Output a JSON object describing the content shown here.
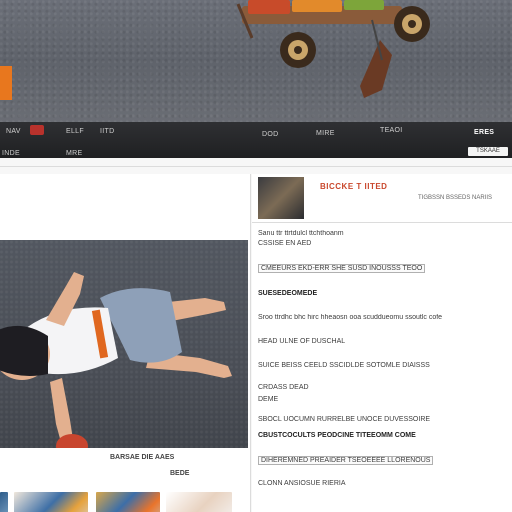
{
  "hero": {
    "icon": "wagon-icon"
  },
  "navbar": {
    "items": [
      {
        "label": "NAV",
        "active": false
      },
      {
        "label": "ELLF",
        "active": false
      },
      {
        "label": "IITD",
        "active": false
      },
      {
        "label": "DOD",
        "active": false
      },
      {
        "label": "MIRE",
        "active": false
      },
      {
        "label": "TEAOI",
        "active": false
      },
      {
        "label": "ERES",
        "active": true
      }
    ],
    "sub_items": [
      {
        "label": "INDE"
      },
      {
        "label": "MRE"
      }
    ],
    "button_label": "TSKAAE"
  },
  "article": {
    "headline": "BICCKE T  IITED",
    "meta": "TIGBSSN BSSEDS NARIIS",
    "lines": [
      {
        "text": "Sanu ttr ttrtdulcl ttchthoanm",
        "style": "normal"
      },
      {
        "text": "CSSISE EN AED",
        "style": "normal"
      },
      {
        "text": "CMEEURS EKD-ERR SHE SUSD INOUSSS TEOO",
        "style": "boxed"
      },
      {
        "text": "SUESEDEOMEDE",
        "style": "bold"
      },
      {
        "text": "Sroo ttrdhc bhc hirc hheaosn ooa scuddueomu ssoutlc cofe",
        "style": "normal"
      },
      {
        "text": "HEAD ULNE OF DUSCHAL",
        "style": "normal"
      },
      {
        "text": "SUICE BEISS CEELD SSCIDLDE SOTOMLE DIAISSS",
        "style": "normal"
      },
      {
        "text": "CRDASS DEAD",
        "style": "normal"
      },
      {
        "text": "DEME",
        "style": "normal"
      },
      {
        "text": "SBOCL UOCUMN RURRELBE UNOCE DUVESSOIRE",
        "style": "normal"
      },
      {
        "text": "CBUSTCOCULTS PEODCINE TITEEOMM COME",
        "style": "bold"
      },
      {
        "text": "DIHEREMNED PREAIDER TSEOEEEE LLORENOUS",
        "style": "boxed"
      },
      {
        "text": "CLONN ANSIOSUE RIERIA",
        "style": "normal"
      }
    ]
  },
  "photo": {
    "caption_line1": "BARSAE DIE AAES",
    "caption_line2": "BEDE"
  },
  "thumbnails": [
    {
      "name": "thumb-1"
    },
    {
      "name": "thumb-2"
    },
    {
      "name": "thumb-3"
    },
    {
      "name": "thumb-4"
    },
    {
      "name": "thumb-5"
    }
  ],
  "colors": {
    "accent": "#c9472c",
    "orange_tab": "#e8771e",
    "navbar": "#262729"
  }
}
